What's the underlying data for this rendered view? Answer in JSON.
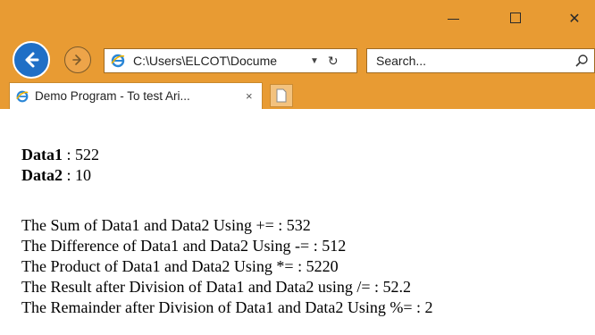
{
  "window": {
    "minimize_label": "—",
    "close_label": "✕"
  },
  "navigation": {
    "address": "C:\\Users\\ELCOT\\Docume",
    "search_placeholder": "Search...",
    "back_icon": "back-arrow-icon",
    "forward_icon": "forward-arrow-icon"
  },
  "tab": {
    "title": "Demo Program - To test Ari...",
    "close_label": "×"
  },
  "content": {
    "data1_label": "Data1",
    "data1_value": " : 522",
    "data2_label": "Data2",
    "data2_value": " : 10",
    "results": [
      "The Sum of Data1 and Data2 Using += : 532",
      "The Difference of Data1 and Data2 Using -= : 512",
      "The Product of Data1 and Data2 Using *= : 5220",
      "The Result after Division of Data1 and Data2 using /= : 52.2",
      "The Remainder after Division of Data1 and Data2 Using %= : 2"
    ]
  }
}
